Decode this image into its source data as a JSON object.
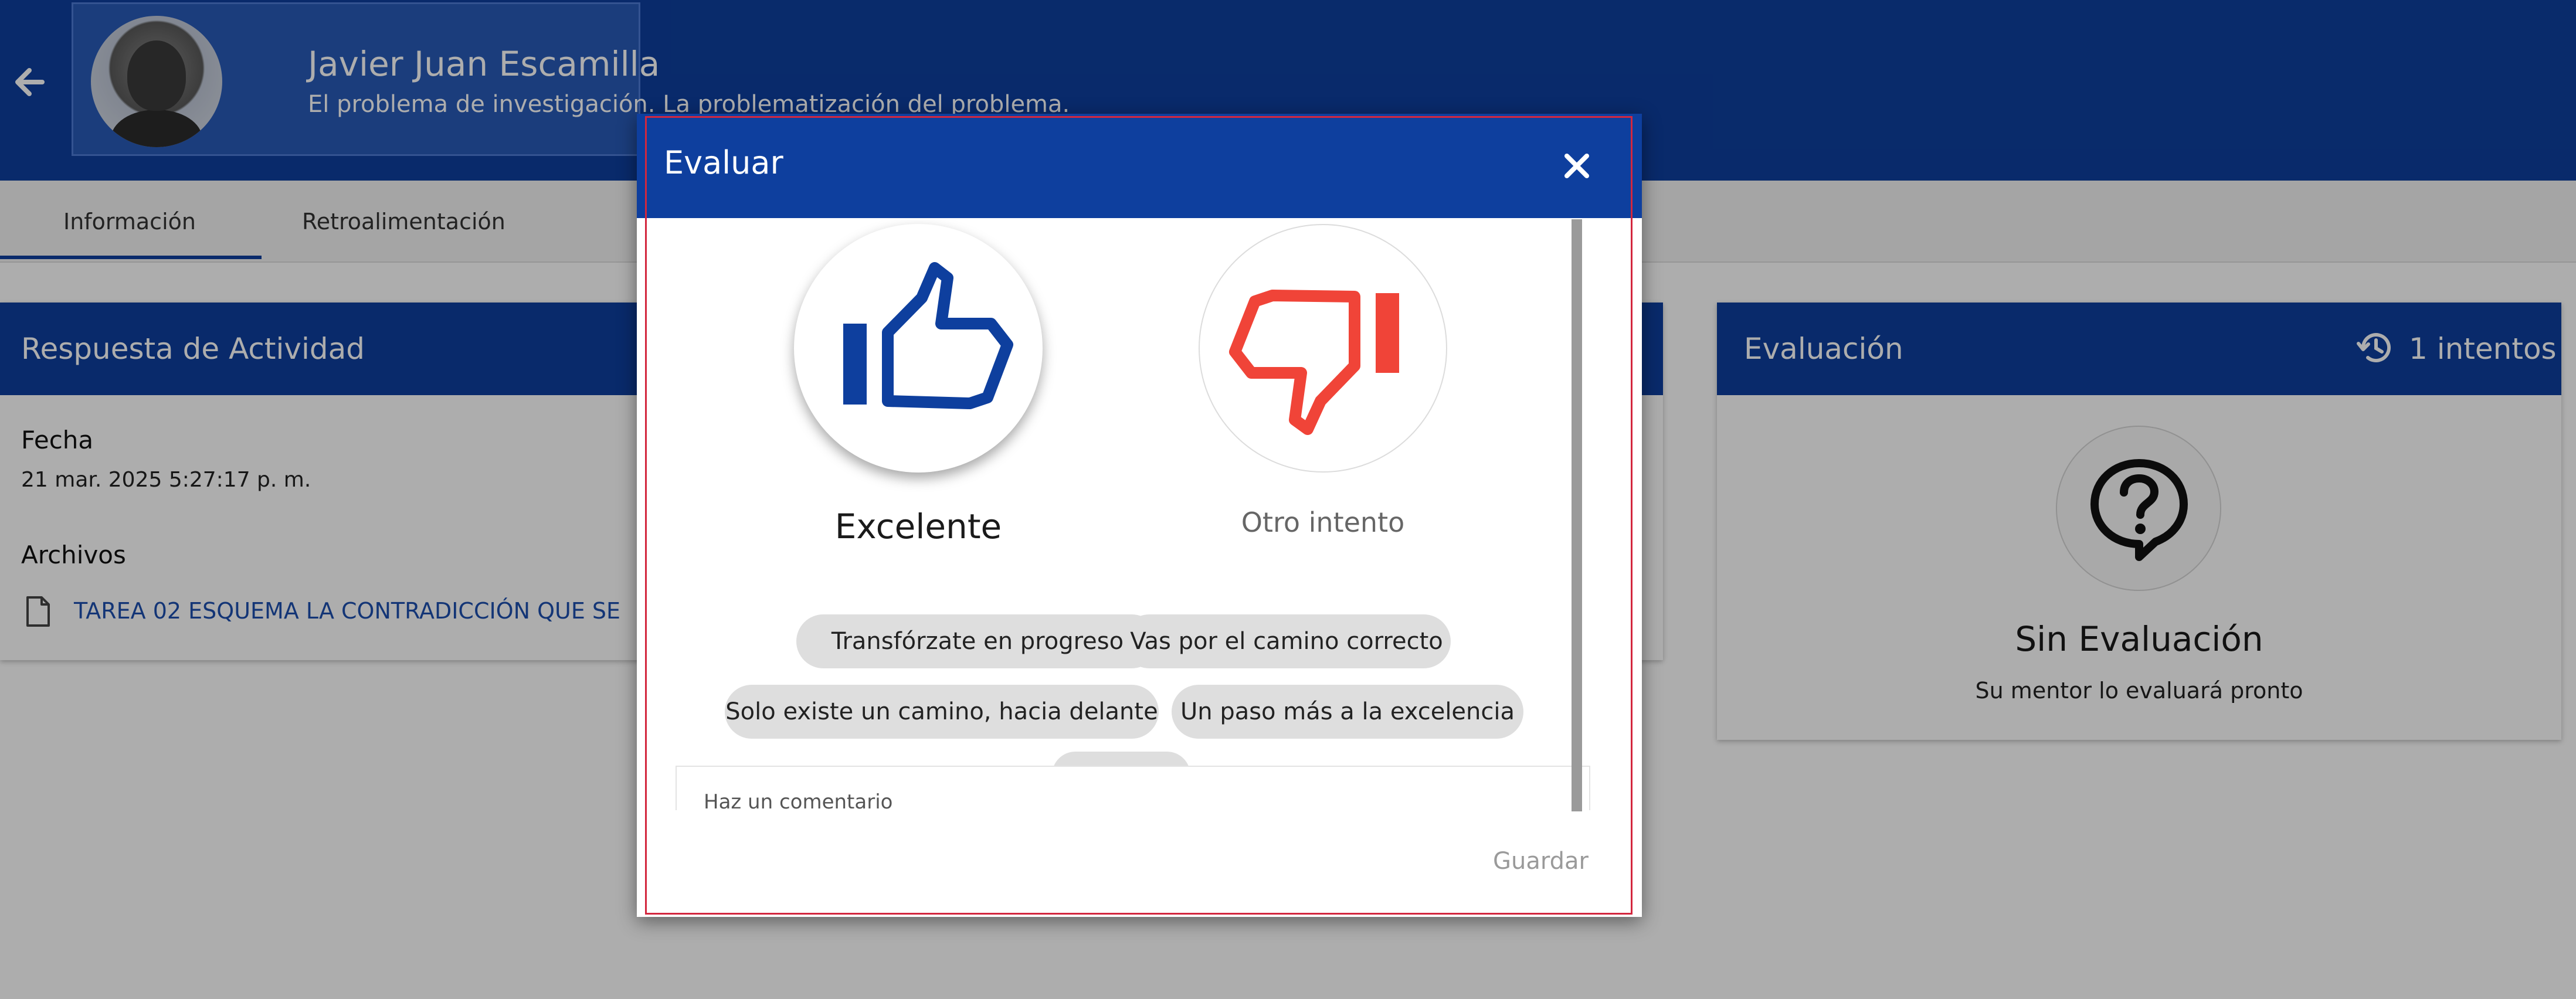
{
  "header": {
    "name": "Javier Juan Escamilla",
    "subtitle": "El problema de investigación. La problematización del problema."
  },
  "tabs": [
    {
      "label": "Información"
    },
    {
      "label": "Retroalimentación"
    }
  ],
  "respuesta": {
    "title": "Respuesta de Actividad",
    "fecha_label": "Fecha",
    "fecha_value": "21 mar. 2025 5:27:17 p. m.",
    "archivos_label": "Archivos",
    "file_name": "TAREA 02 ESQUEMA LA CONTRADICCIÓN QUE SE"
  },
  "evaluacion": {
    "title": "Evaluación",
    "intentos": "1 intentos",
    "status": "Sin Evaluación",
    "message": "Su mentor lo evaluará pronto"
  },
  "dialog": {
    "title": "Evaluar",
    "good_label": "Excelente",
    "bad_label": "Otro intento",
    "chips": [
      "Transfórzate en progreso",
      "Vas por el camino correcto",
      "Solo existe un camino, hacia delante",
      "Un paso más a la excelencia"
    ],
    "comment_placeholder": "Haz un comentario",
    "save_label": "Guardar"
  },
  "colors": {
    "primary": "#0e3f9e",
    "positive": "#0e3f9e",
    "negative": "#f04438",
    "focus": "#d3273e"
  },
  "icons": [
    "back-arrow-icon",
    "file-icon",
    "history-icon",
    "question-bubble-icon",
    "close-icon",
    "thumbs-up-icon",
    "thumbs-down-icon"
  ]
}
